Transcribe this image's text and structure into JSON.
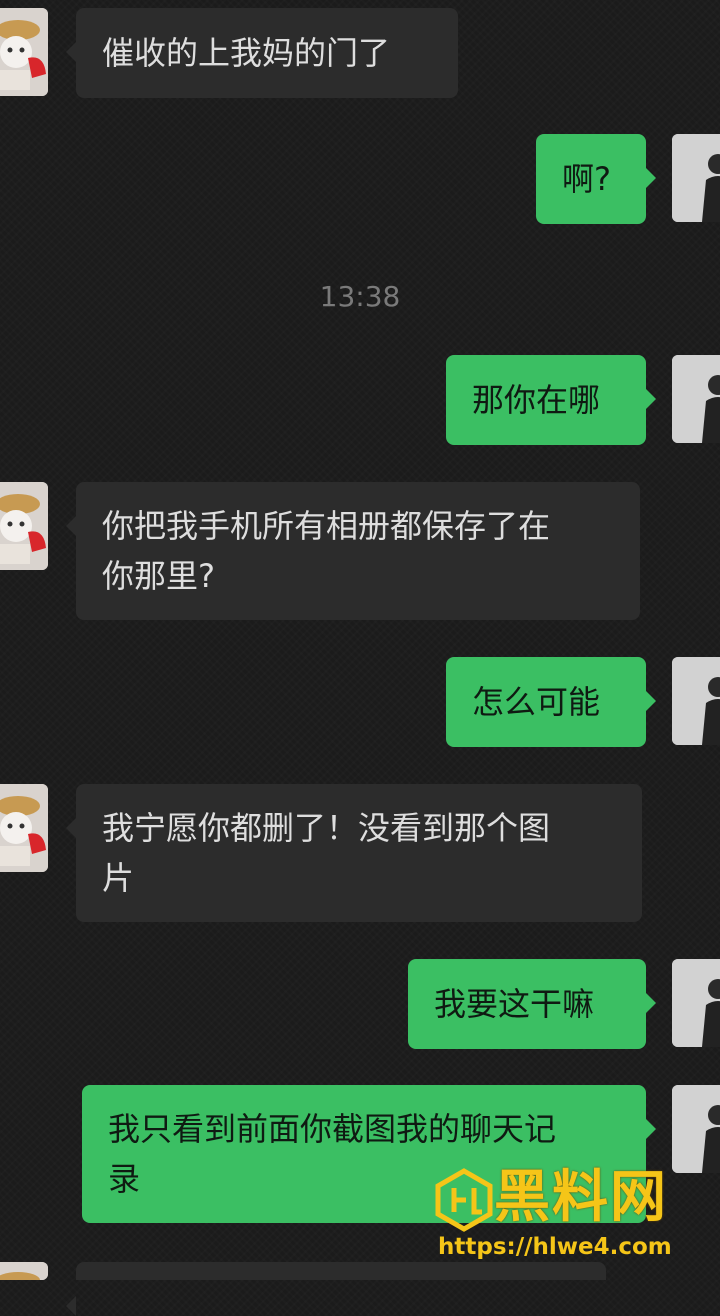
{
  "messages": [
    {
      "side": "in",
      "text": "催收的上我妈的门了"
    },
    {
      "side": "out",
      "text": "啊?"
    },
    {
      "side": "out",
      "text": "那你在哪"
    },
    {
      "side": "in",
      "text": "你把我手机所有相册都保存了在\n你那里?"
    },
    {
      "side": "out",
      "text": "怎么可能"
    },
    {
      "side": "in",
      "text": "我宁愿你都删了！没看到那个图\n片"
    },
    {
      "side": "out",
      "text": "我要这干嘛"
    },
    {
      "side": "out",
      "text": "我只看到前面你截图我的聊天记\n录"
    }
  ],
  "timestamp": "13:38",
  "watermark": {
    "name": "黑料网",
    "url": "https://hlwe4.com"
  },
  "colors": {
    "outgoing_bubble": "#3bbf63",
    "incoming_bubble": "#2c2c2c",
    "background": "#1b1b1b",
    "watermark": "#f5c518"
  }
}
